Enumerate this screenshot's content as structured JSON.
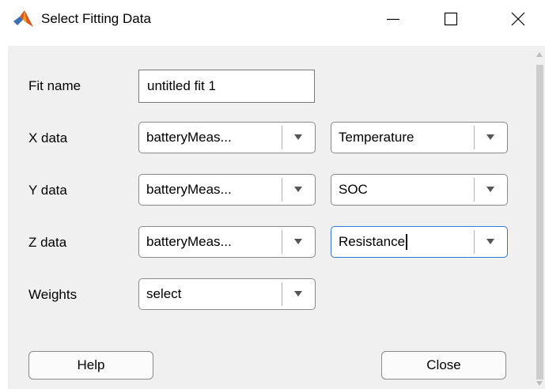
{
  "window": {
    "title": "Select Fitting Data"
  },
  "form": {
    "fit_name_label": "Fit name",
    "fit_name_value": "untitled fit 1",
    "x_label": "X data",
    "x_workspace": "batteryMeas...",
    "x_variable": "Temperature",
    "y_label": "Y data",
    "y_workspace": "batteryMeas...",
    "y_variable": "SOC",
    "z_label": "Z data",
    "z_workspace": "batteryMeas...",
    "z_variable": "Resistance",
    "weights_label": "Weights",
    "weights_value": "select"
  },
  "buttons": {
    "help": "Help",
    "close": "Close"
  },
  "icons": {
    "app": "matlab-logo-icon",
    "minimize": "minimize-icon",
    "maximize": "maximize-icon",
    "close": "close-icon"
  },
  "colors": {
    "focus": "#2e7bd3",
    "dialog_bg": "#f0f0f0"
  }
}
